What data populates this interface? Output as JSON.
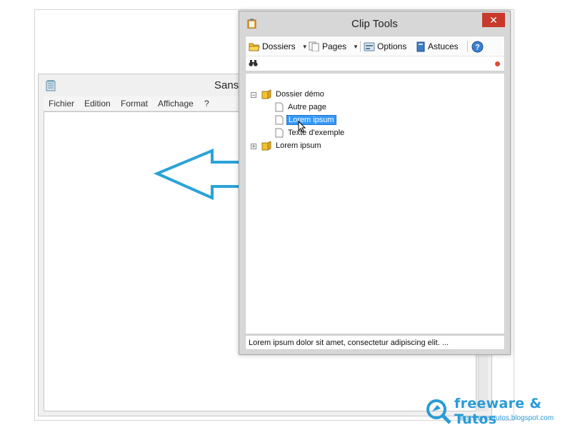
{
  "notepad": {
    "title": "Sans",
    "menu": [
      "Fichier",
      "Edition",
      "Format",
      "Affichage",
      "?"
    ]
  },
  "cliptools": {
    "title": "Clip Tools",
    "close_glyph": "✕",
    "toolbar": {
      "dossiers": "Dossiers",
      "pages": "Pages",
      "options": "Options",
      "astuces": "Astuces",
      "help_glyph": "?"
    },
    "tree": {
      "folder1": "Dossier démo",
      "page1": "Autre page",
      "page2": "Lorem ipsum",
      "page3": "Texte d'exemple",
      "folder2": "Lorem ipsum"
    },
    "status": "Lorem ipsum dolor sit amet, consectetur adipiscing elit. ..."
  },
  "watermark": {
    "brand": "freeware & Tutos",
    "url": "freewares-tutos.blogspot.com"
  },
  "colors": {
    "accent_blue": "#2a9bd6",
    "close_red": "#c7392b",
    "selection": "#3399ff",
    "folder_yellow": "#f2c230"
  },
  "icons": {
    "notepad": "notepad-icon",
    "clipboard": "clipboard-icon",
    "folder": "folder-icon",
    "page": "page-icon",
    "options": "options-icon",
    "book": "book-icon",
    "help": "help-icon",
    "search": "binoculars-icon",
    "arrow": "left-arrow-icon"
  }
}
